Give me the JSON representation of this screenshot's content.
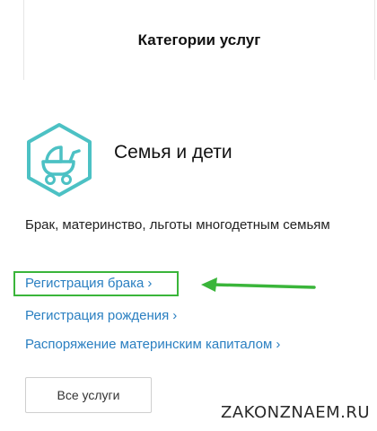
{
  "header": {
    "title": "Категории услуг"
  },
  "category": {
    "icon": "baby-stroller-icon",
    "icon_color": "#4cc1c4",
    "title": "Семья и дети",
    "description": "Брак, материнство, льготы многодетным семьям"
  },
  "links": [
    {
      "label": "Регистрация брака",
      "chevron": "›"
    },
    {
      "label": "Регистрация рождения",
      "chevron": "›"
    },
    {
      "label": "Распоряжение материнским капиталом",
      "chevron": "›"
    }
  ],
  "all_services_button": "Все услуги",
  "watermark": "ZAKONZNAEM.RU",
  "colors": {
    "link": "#2a7fc1",
    "highlight": "#3ab53a",
    "icon": "#4cc1c4"
  }
}
